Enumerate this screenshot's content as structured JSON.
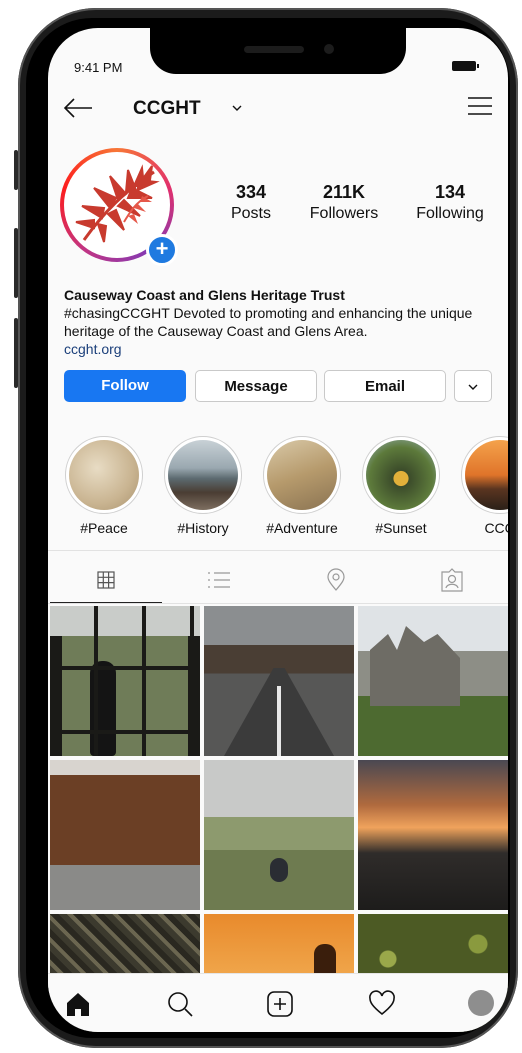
{
  "status": {
    "time": "9:41 PM"
  },
  "header": {
    "username": "CCGHT"
  },
  "profile": {
    "stats": [
      {
        "value": "334",
        "label": "Posts"
      },
      {
        "value": "211K",
        "label": "Followers"
      },
      {
        "value": "134",
        "label": "Following"
      }
    ],
    "bio": {
      "name": "Causeway Coast and Glens Heritage Trust",
      "text": "#chasingCCGHT Devoted to promoting and enhancing the unique heritage of the Causeway Coast and Glens Area.",
      "link": "ccght.org"
    }
  },
  "actions": {
    "follow": "Follow",
    "message": "Message",
    "email": "Email"
  },
  "highlights": [
    {
      "label": "#Peace"
    },
    {
      "label": "#History"
    },
    {
      "label": "#Adventure"
    },
    {
      "label": "#Sunset"
    },
    {
      "label": "CCG"
    }
  ],
  "tabs": [
    "grid-icon",
    "list-icon",
    "location-pin-icon",
    "tagged-user-icon"
  ],
  "bottom_nav": [
    "home-icon",
    "search-icon",
    "add-post-icon",
    "heart-icon",
    "profile-avatar"
  ],
  "colors": {
    "accent": "#1877f2",
    "logo_red": "#c83a2e"
  }
}
